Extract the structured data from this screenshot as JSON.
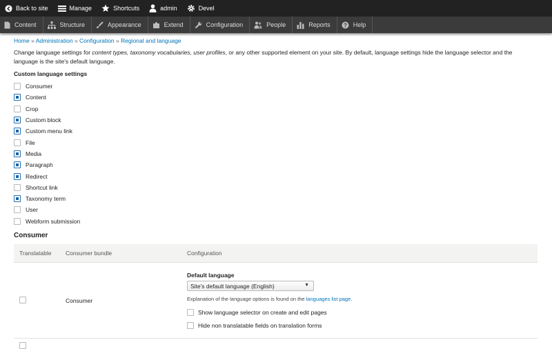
{
  "toolbar_top": {
    "back": "Back to site",
    "manage": "Manage",
    "shortcuts": "Shortcuts",
    "user": "admin",
    "devel": "Devel"
  },
  "menu": {
    "content": "Content",
    "structure": "Structure",
    "appearance": "Appearance",
    "extend": "Extend",
    "configuration": "Configuration",
    "people": "People",
    "reports": "Reports",
    "help": "Help"
  },
  "breadcrumb": {
    "home": "Home",
    "administration": "Administration",
    "configuration": "Configuration",
    "regional": "Regional and language",
    "separator": "»"
  },
  "intro": {
    "part1": "Change language settings for ",
    "em": "content types, taxonomy vocabularies, user profiles",
    "part2": ", or any other supported element on your site. By default, language settings hide the language selector and the language is the site's default language."
  },
  "custom_settings": {
    "label": "Custom language settings",
    "items": [
      {
        "label": "Consumer",
        "checked": false
      },
      {
        "label": "Content",
        "checked": true
      },
      {
        "label": "Crop",
        "checked": false
      },
      {
        "label": "Custom block",
        "checked": true
      },
      {
        "label": "Custom menu link",
        "checked": true
      },
      {
        "label": "File",
        "checked": false
      },
      {
        "label": "Media",
        "checked": true
      },
      {
        "label": "Paragraph",
        "checked": true
      },
      {
        "label": "Redirect",
        "checked": true
      },
      {
        "label": "Shortcut link",
        "checked": false
      },
      {
        "label": "Taxonomy term",
        "checked": true
      },
      {
        "label": "User",
        "checked": false
      },
      {
        "label": "Webform submission",
        "checked": false
      }
    ]
  },
  "consumer_section": {
    "title": "Consumer",
    "headers": {
      "translatable": "Translatable",
      "bundle": "Consumer bundle",
      "configuration": "Configuration"
    },
    "row": {
      "bundle": "Consumer",
      "default_language_label": "Default language",
      "default_language_value": "Site's default language (English)",
      "explain_text": "Explanation of the language options is found on the ",
      "explain_link": "languages list page",
      "explain_end": ".",
      "opt_selector": "Show language selector on create and edit pages",
      "opt_hide": "Hide non translatable fields on translation forms"
    }
  },
  "colors": {
    "toolbar_dark": "#222222",
    "menu_bar": "#3b3b3b",
    "link": "#0073b9",
    "checkbox_checked": "#1a62a8"
  }
}
